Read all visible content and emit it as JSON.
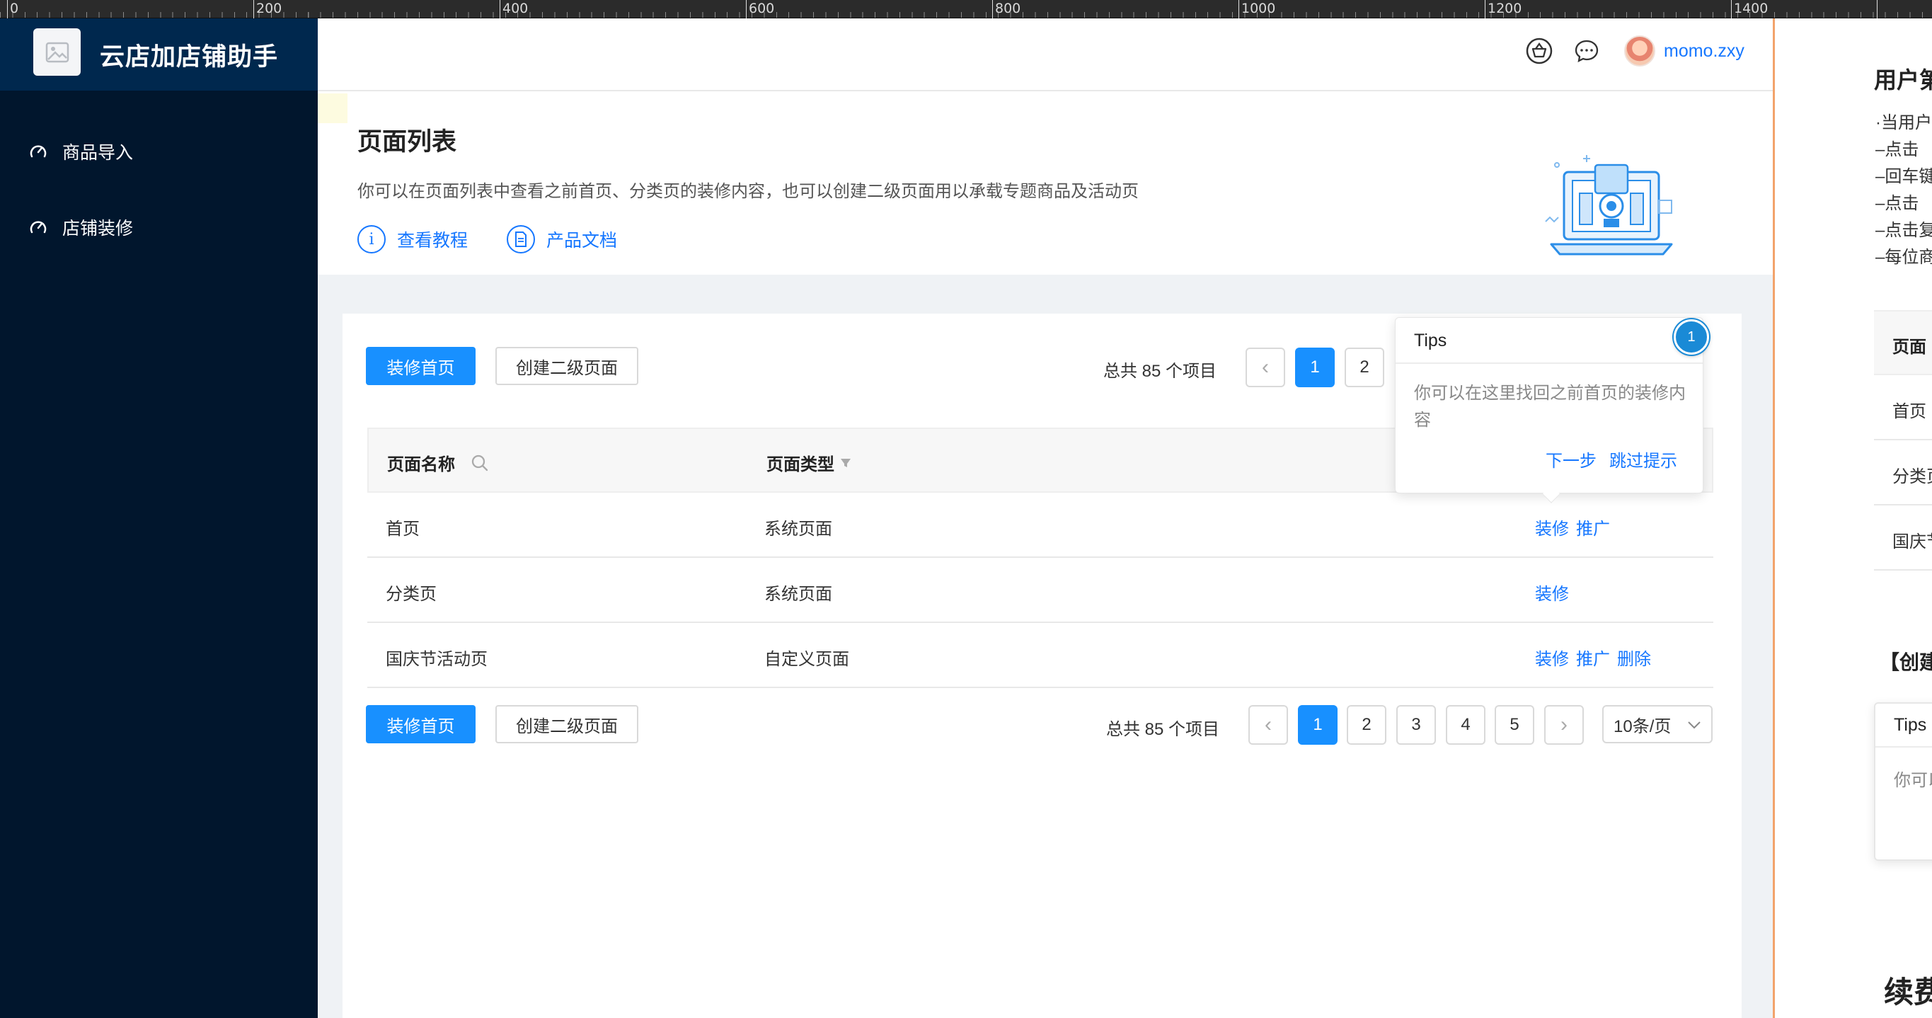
{
  "ruler": {
    "labels": [
      "0",
      "200",
      "400",
      "600",
      "800",
      "1000",
      "1200",
      "1400"
    ]
  },
  "app": {
    "brand_title": "云店加店铺助手"
  },
  "sidebar": {
    "items": [
      {
        "label": "商品导入",
        "icon": "dashboard-gauge-icon"
      },
      {
        "label": "店铺装修",
        "icon": "dashboard-gauge-icon"
      }
    ]
  },
  "header": {
    "icons": [
      "basket-icon",
      "chat-bubble-icon"
    ],
    "username": "momo.zxy"
  },
  "page": {
    "title": "页面列表",
    "description": "你可以在页面列表中查看之前首页、分类页的装修内容，也可以创建二级页面用以承载专题商品及活动页",
    "links": [
      {
        "label": "查看教程",
        "icon": "info-icon"
      },
      {
        "label": "产品文档",
        "icon": "document-icon"
      }
    ]
  },
  "toolbar": {
    "primary_button": "装修首页",
    "secondary_button": "创建二级页面"
  },
  "pagination": {
    "total_text": "总共 85 个项目",
    "pages": [
      "1",
      "2",
      "3",
      "4",
      "5"
    ],
    "current": "1",
    "page_size": "10条/页"
  },
  "table": {
    "columns": [
      {
        "label": "页面名称",
        "icon": "search-icon"
      },
      {
        "label": "页面类型",
        "icon": "filter-icon"
      }
    ],
    "rows": [
      {
        "name": "首页",
        "type": "系统页面",
        "actions": [
          "装修",
          "推广"
        ]
      },
      {
        "name": "分类页",
        "type": "系统页面",
        "actions": [
          "装修"
        ]
      },
      {
        "name": "国庆节活动页",
        "type": "自定义页面",
        "actions": [
          "装修",
          "推广",
          "删除"
        ]
      }
    ]
  },
  "tips": {
    "title": "Tips",
    "body": "你可以在这里找回之前首页的装修内容",
    "next": "下一步",
    "skip": "跳过提示",
    "step": "1"
  },
  "right_panel": {
    "title": "用户第",
    "lines": [
      "·当用户",
      "–点击",
      "–回车键",
      "–点击",
      "–点击复",
      "–每位商"
    ],
    "table_header": "页面",
    "rows": [
      "首页",
      "分类页",
      "国庆节"
    ],
    "section_title": "【创建",
    "tips_title": "Tips",
    "tips_body": "你可以",
    "bottom_title": "续费"
  },
  "colors": {
    "primary": "#1890ff",
    "sidebar_bg": "#01162d",
    "brand_bg": "#00284e",
    "link": "#1677ff",
    "artboard_border": "#f2a36b"
  }
}
